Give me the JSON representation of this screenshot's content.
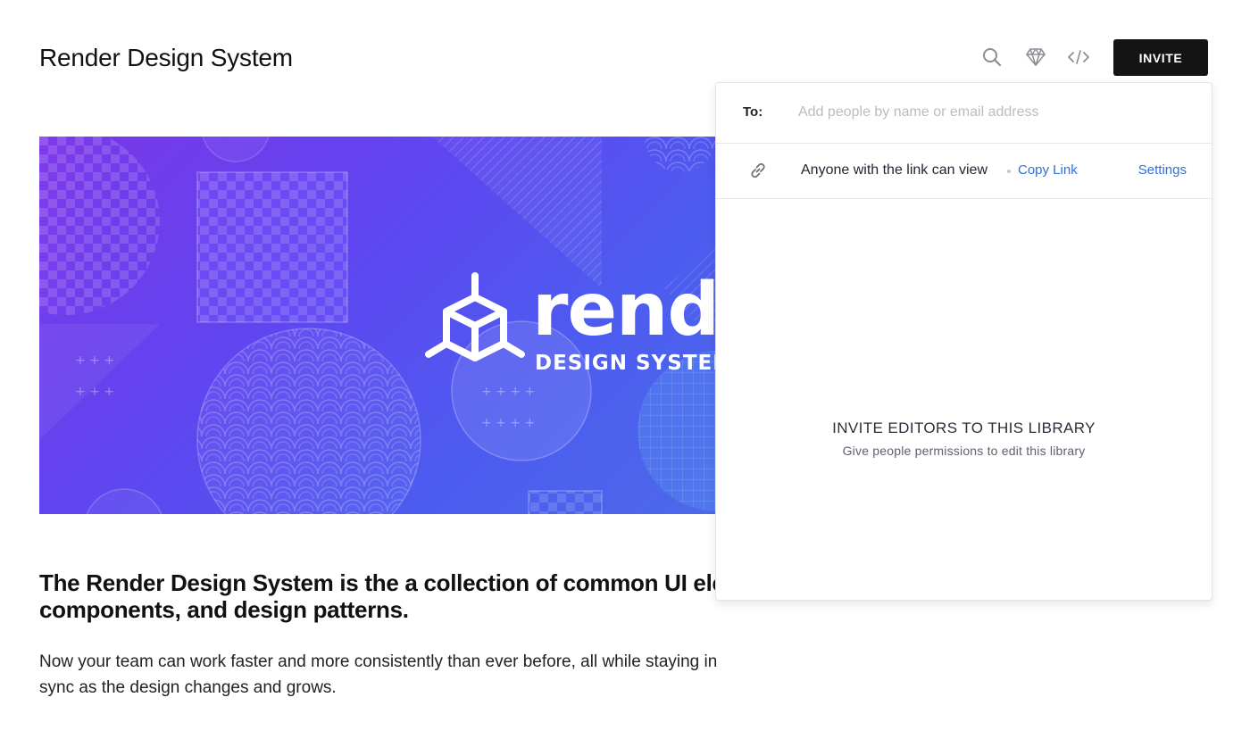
{
  "page": {
    "title": "Render Design System"
  },
  "toolbar": {
    "icons": [
      "search-icon",
      "sketch-diamond-icon",
      "code-icon"
    ],
    "invite_label": "INVITE"
  },
  "hero": {
    "logo_word": "render",
    "logo_tagline": "DESIGN SYSTEM"
  },
  "content": {
    "headline_line1": "The Render Design System is the a collection of common UI elements,",
    "headline_line2": "components, and design patterns.",
    "body_line1": "Now your team can work faster and more consistently than ever before, all while staying in",
    "body_line2": "sync as the design changes and grows."
  },
  "invite_panel": {
    "to_label": "To:",
    "to_placeholder": "Add people by name or email address",
    "to_value": "",
    "link_permission_text": "Anyone with the link can view",
    "copy_link_label": "Copy Link",
    "settings_label": "Settings",
    "empty_title": "INVITE EDITORS TO THIS LIBRARY",
    "empty_subtitle": "Give people permissions to edit this library"
  },
  "colors": {
    "accent_link": "#2f6fd8",
    "invite_button_bg": "#141414",
    "hero_gradient_start": "#7b36e8",
    "hero_gradient_end": "#4c69ea"
  }
}
